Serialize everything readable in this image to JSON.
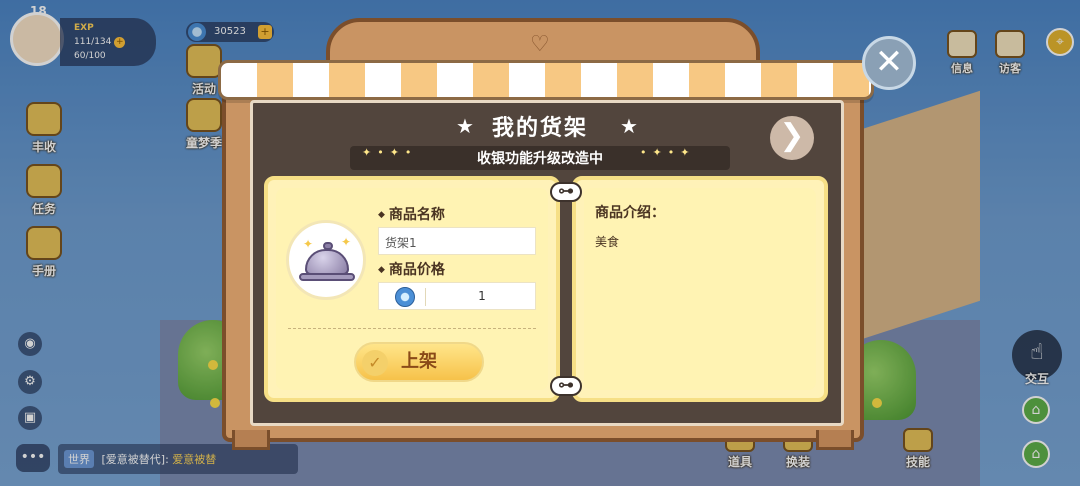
{
  "hud": {
    "level": "18",
    "exp_label": "EXP",
    "energy": "111/134",
    "stamina": "60/100",
    "coins": "30523"
  },
  "sidebar": {
    "items": [
      {
        "label": "活动"
      },
      {
        "label": "童梦季"
      },
      {
        "label": "丰收"
      },
      {
        "label": "任务"
      },
      {
        "label": "手册"
      }
    ]
  },
  "top_right": {
    "items": [
      {
        "label": "信息"
      },
      {
        "label": "访客"
      }
    ]
  },
  "bottom_bar": {
    "items": [
      {
        "label": "道具"
      },
      {
        "label": "换装"
      },
      {
        "label": "技能"
      }
    ]
  },
  "interact_label": "交互",
  "chat": {
    "channel": "世界",
    "sender": "[爱意被替代]:",
    "message": "爱意被替"
  },
  "modal": {
    "title": "我的货架",
    "subtitle": "收银功能升级改造中",
    "next_symbol": "❯",
    "close_symbol": "✕",
    "name_label": "商品名称",
    "name_value": "货架1",
    "price_label": "商品价格",
    "price_value": "1",
    "shelve_button": "上架",
    "desc_label": "商品介绍：",
    "desc_text": "美食"
  },
  "icons": {
    "coin": "blue-coin-icon",
    "dish": "covered-dish-icon",
    "close": "close-icon",
    "next": "arrow-right-icon"
  },
  "colors": {
    "board": "#52453d",
    "panel": "#fff2b8",
    "frame_wood": "#c99463",
    "button_gold": "#f6c24a"
  }
}
